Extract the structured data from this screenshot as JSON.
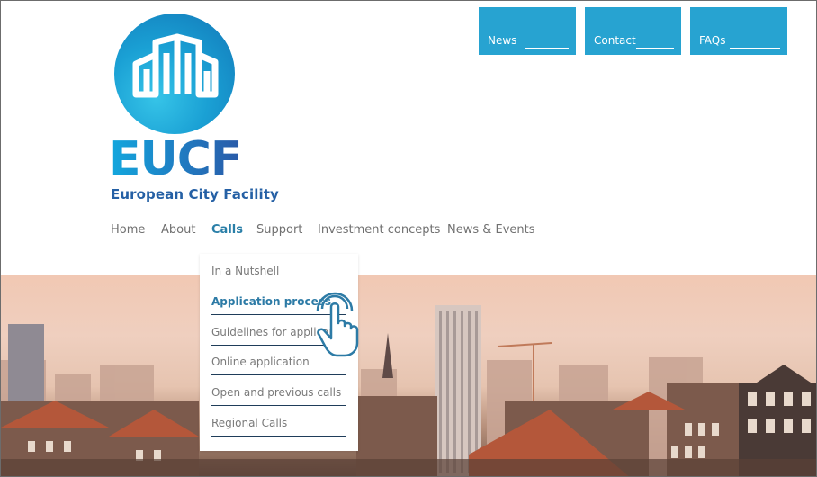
{
  "top_nav": [
    {
      "label": "News"
    },
    {
      "label": "Contact"
    },
    {
      "label": "FAQs"
    }
  ],
  "logo": {
    "word": "EUCF",
    "subtitle": "European City Facility"
  },
  "main_nav": [
    {
      "label": "Home"
    },
    {
      "label": "About"
    },
    {
      "label": "Calls",
      "active": true
    },
    {
      "label": "Support"
    },
    {
      "label": "Investment concepts"
    },
    {
      "label": "News & Events"
    }
  ],
  "calls_dropdown": [
    {
      "label": "In a Nutshell"
    },
    {
      "label": "Application process",
      "active": true
    },
    {
      "label": "Guidelines for applicants"
    },
    {
      "label": "Online application"
    },
    {
      "label": "Open and previous calls"
    },
    {
      "label": "Regional Calls"
    }
  ],
  "colors": {
    "accent": "#27a3d1",
    "active_text": "#2d7ba6",
    "logo_blue": "#2560a5"
  },
  "icons": {
    "cursor": "pointer-hand-icon",
    "logo": "building-logo-icon"
  }
}
